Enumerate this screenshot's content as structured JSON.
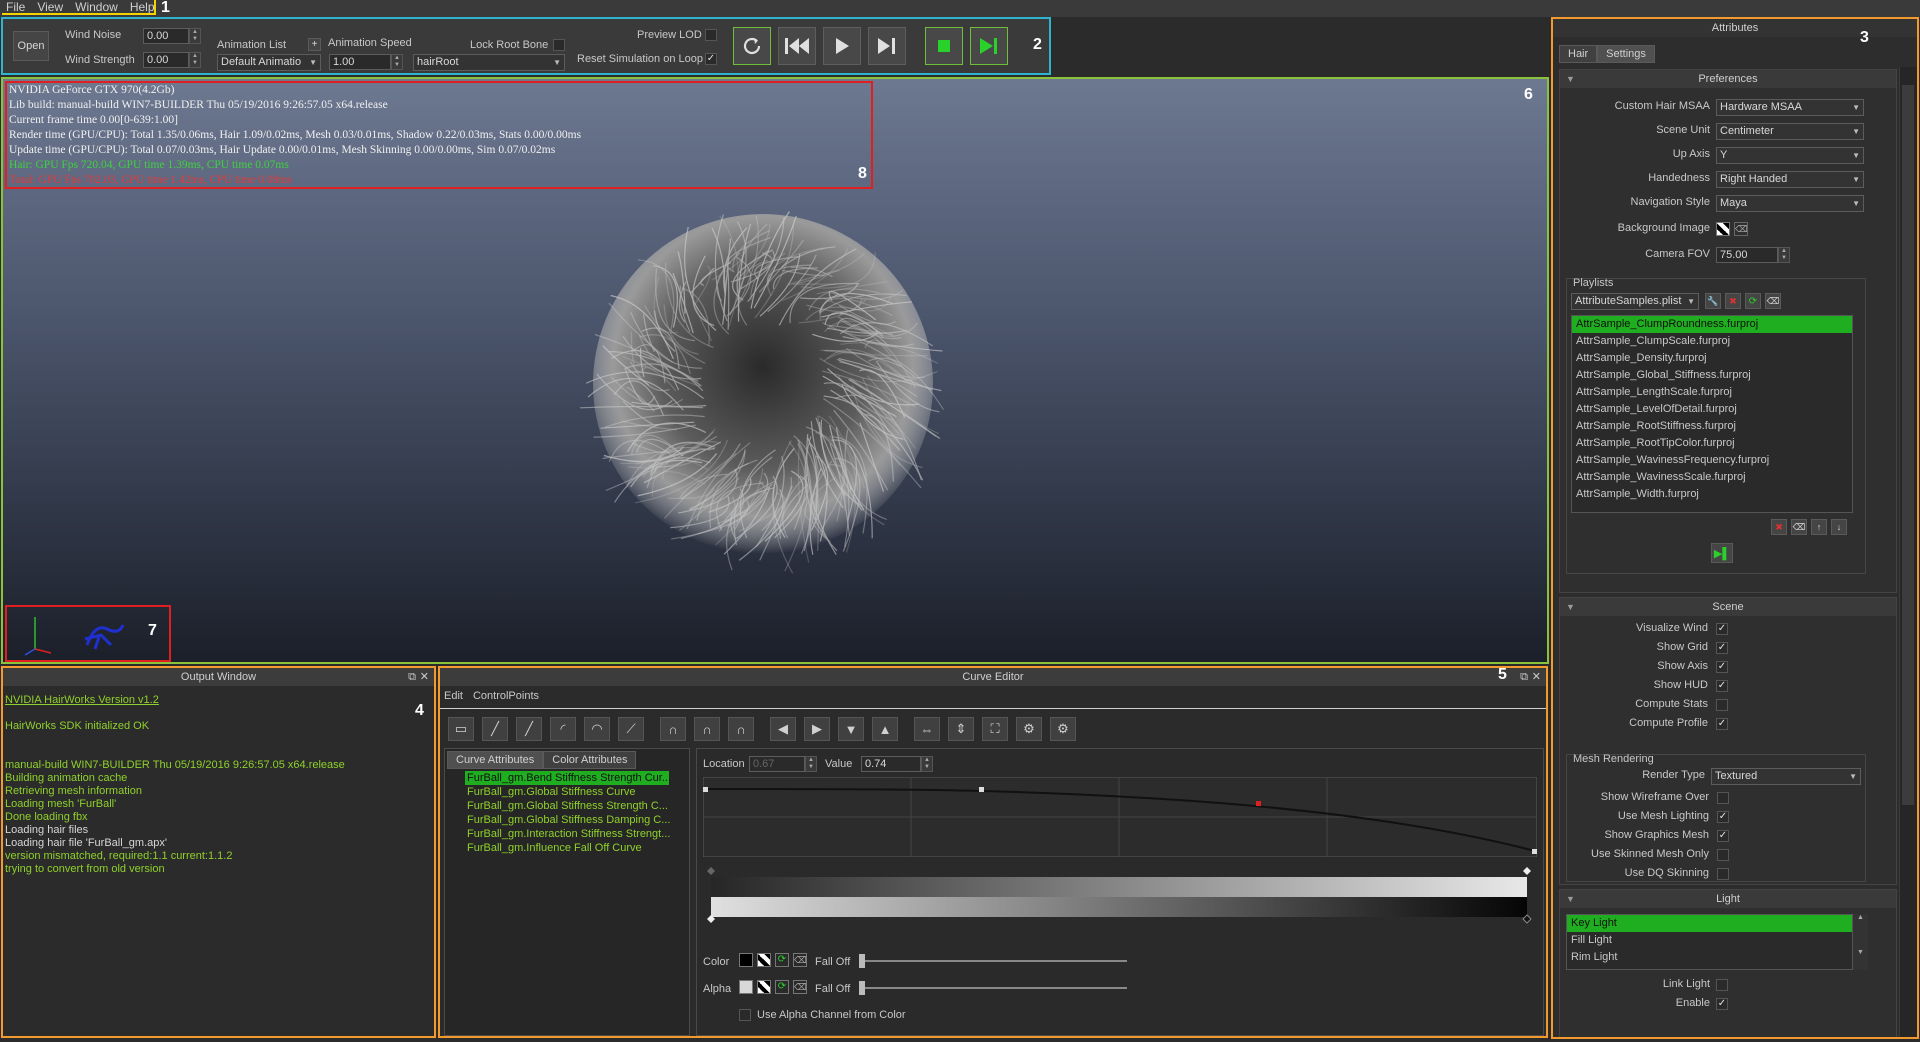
{
  "menu": {
    "items": [
      "File",
      "View",
      "Window",
      "Help"
    ],
    "region_number": "1"
  },
  "toolbar": {
    "region_number": "2",
    "open_label": "Open",
    "wind_noise_label": "Wind Noise",
    "wind_noise_value": "0.00",
    "wind_strength_label": "Wind Strength",
    "wind_strength_value": "0.00",
    "animation_list_label": "Animation List",
    "animation_list_value": "Default Animatio",
    "animation_speed_label": "Animation Speed",
    "animation_speed_value": "1.00",
    "lock_root_bone_label": "Lock Root Bone",
    "root_bone_value": "hairRoot",
    "preview_lod_label": "Preview LOD",
    "reset_sim_label": "Reset Simulation on Loop",
    "reset_sim_checked": "✓"
  },
  "viewport": {
    "region_number": "6",
    "hud_region_number": "8",
    "axis_region_number": "7",
    "hud_lines": [
      "NVIDIA GeForce GTX 970(4.2Gb)",
      "Lib build: manual-build WIN7-BUILDER Thu 05/19/2016  9:26:57.05 x64.release",
      "Current frame time 0.00[0-639:1.00]",
      "Render time (GPU/CPU): Total 1.35/0.06ms, Hair 1.09/0.02ms, Mesh 0.03/0.01ms, Shadow 0.22/0.03ms, Stats 0.00/0.00ms",
      "Update time (GPU/CPU): Total 0.07/0.03ms, Hair Update 0.00/0.01ms, Mesh Skinning 0.00/0.00ms, Sim 0.07/0.02ms",
      "Hair: GPU Fps 720.04, GPU time 1.39ms, CPU time 0.07ms",
      "Total: GPU Fps 702.03, GPU time 1.42ms, CPU time 0.08ms"
    ],
    "hud_line_colors": [
      "#f0f0f0",
      "#f0f0f0",
      "#f0f0f0",
      "#f0f0f0",
      "#f0f0f0",
      "#3fd23f",
      "#e23b3b"
    ]
  },
  "output": {
    "title": "Output Window",
    "region_number": "4",
    "lines": [
      {
        "text": "NVIDIA HairWorks Version v1.2",
        "color": "green",
        "underline": true
      },
      {
        "text": "",
        "color": "green"
      },
      {
        "text": "HairWorks SDK initialized OK",
        "color": "green"
      },
      {
        "text": "",
        "color": "green"
      },
      {
        "text": "",
        "color": "green"
      },
      {
        "text": "manual-build WIN7-BUILDER Thu 05/19/2016  9:26:57.05 x64.release",
        "color": "green"
      },
      {
        "text": "Building animation cache",
        "color": "green"
      },
      {
        "text": "Retrieving mesh information",
        "color": "green"
      },
      {
        "text": "Loading mesh 'FurBall'",
        "color": "green"
      },
      {
        "text": "Done loading fbx",
        "color": "green"
      },
      {
        "text": "Loading hair files",
        "color": "white"
      },
      {
        "text": "Loading hair file 'FurBall_gm.apx'",
        "color": "white"
      },
      {
        "text": "version mismatched, required:1.1 current:1.1.2",
        "color": "green"
      },
      {
        "text": "trying to convert from old version",
        "color": "green"
      }
    ]
  },
  "curve_editor": {
    "title": "Curve Editor",
    "region_number": "5",
    "menu": [
      "Edit",
      "ControlPoints"
    ],
    "tabs": [
      "Curve Attributes",
      "Color Attributes"
    ],
    "curves": [
      "FurBall_gm.Bend Stiffness Strength Cur...",
      "FurBall_gm.Global Stiffness Curve",
      "FurBall_gm.Global Stiffness Strength C...",
      "FurBall_gm.Global Stiffness Damping C...",
      "FurBall_gm.Interaction Stiffness Strengt...",
      "FurBall_gm.Influence Fall Off Curve"
    ],
    "location_label": "Location",
    "location_value": "0.67",
    "value_label": "Value",
    "value_value": "0.74",
    "color_label": "Color",
    "alpha_label": "Alpha",
    "fall_off_label": "Fall Off",
    "use_alpha_label": "Use Alpha Channel from Color"
  },
  "attributes": {
    "title": "Attributes",
    "region_number": "3",
    "tabs": [
      "Hair",
      "Settings"
    ],
    "preferences": {
      "title": "Preferences",
      "rows": [
        {
          "label": "Custom Hair MSAA",
          "value": "Hardware MSAA"
        },
        {
          "label": "Scene Unit",
          "value": "Centimeter"
        },
        {
          "label": "Up Axis",
          "value": "Y"
        },
        {
          "label": "Handedness",
          "value": "Right Handed"
        },
        {
          "label": "Navigation Style",
          "value": "Maya"
        }
      ],
      "background_image_label": "Background Image",
      "camera_fov_label": "Camera FOV",
      "camera_fov_value": "75.00",
      "playlists_label": "Playlists",
      "playlist_file": "AttributeSamples.plist",
      "playlist_items": [
        "AttrSample_ClumpRoundness.furproj",
        "AttrSample_ClumpScale.furproj",
        "AttrSample_Density.furproj",
        "AttrSample_Global_Stiffness.furproj",
        "AttrSample_LengthScale.furproj",
        "AttrSample_LevelOfDetail.furproj",
        "AttrSample_RootStiffness.furproj",
        "AttrSample_RootTipColor.furproj",
        "AttrSample_WavinessFrequency.furproj",
        "AttrSample_WavinessScale.furproj",
        "AttrSample_Width.furproj"
      ]
    },
    "scene": {
      "title": "Scene",
      "toggles": [
        {
          "label": "Visualize Wind",
          "mark": "✓"
        },
        {
          "label": "Show Grid",
          "mark": "✓"
        },
        {
          "label": "Show Axis",
          "mark": "✓"
        },
        {
          "label": "Show HUD",
          "mark": "✓"
        },
        {
          "label": "Compute Stats",
          "mark": ""
        },
        {
          "label": "Compute Profile",
          "mark": "✓"
        }
      ],
      "mesh_rendering_label": "Mesh Rendering",
      "render_type_label": "Render Type",
      "render_type_value": "Textured",
      "mesh_toggles": [
        {
          "label": "Show Wireframe Over",
          "mark": ""
        },
        {
          "label": "Use Mesh Lighting",
          "mark": "✓"
        },
        {
          "label": "Show Graphics Mesh",
          "mark": "✓"
        },
        {
          "label": "Use Skinned Mesh Only",
          "mark": ""
        },
        {
          "label": "Use DQ Skinning",
          "mark": ""
        }
      ]
    },
    "light": {
      "title": "Light",
      "items": [
        "Key Light",
        "Fill Light",
        "Rim Light"
      ],
      "link_light_label": "Link Light",
      "link_light_mark": "",
      "enable_label": "Enable",
      "enable_mark": "✓"
    }
  }
}
